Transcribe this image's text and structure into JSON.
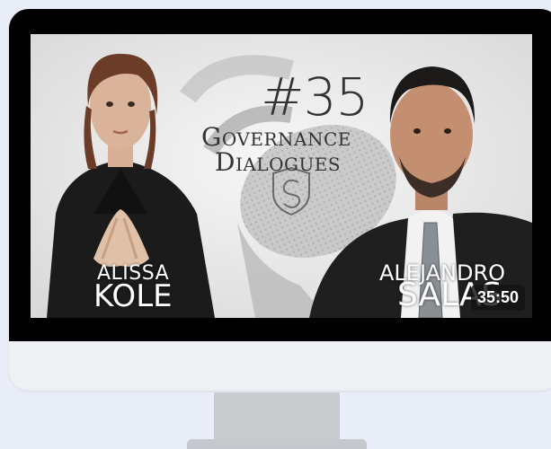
{
  "thumbnail": {
    "episode_number": "#35",
    "title_line1": "Governance",
    "title_line2": "Dialogues",
    "guest_left": {
      "first": "ALISSA",
      "last": "KOLE"
    },
    "guest_right": {
      "first": "ALEJANDRO",
      "last": "SALAS"
    },
    "duration": "35:50"
  },
  "colors": {
    "background": "#e8edf7",
    "bezel": "#000000",
    "monitor_body": "#eff0f3",
    "stand": "#c9cccf"
  },
  "icons": [
    "shield-logo-icon",
    "microphone-graphic"
  ]
}
